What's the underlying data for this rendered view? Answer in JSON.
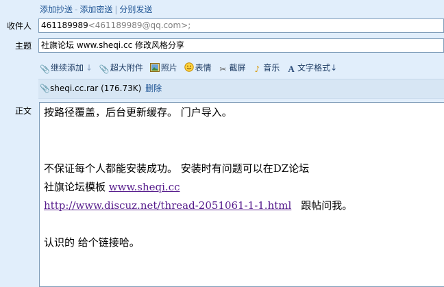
{
  "top_links": {
    "add_cc": "添加抄送",
    "sep1": "-",
    "add_bcc": "添加密送",
    "sep2": "|",
    "send_separately": "分别发送"
  },
  "recipients": {
    "label": "收件人",
    "name": "461189989",
    "email": "<461189989@qq.com>;"
  },
  "subject": {
    "label": "主题",
    "value": "社旗论坛 www.sheqi.cc 修改风格分享"
  },
  "toolbar": {
    "continue_add": "继续添加",
    "large_attachment": "超大附件",
    "photo": "照片",
    "emoticon": "表情",
    "screenshot": "截屏",
    "music": "音乐",
    "text_format": "文字格式"
  },
  "attachment": {
    "filename": "sheqi.cc.rar",
    "size": "(176.73K)",
    "delete": "删除"
  },
  "body": {
    "label": "正文",
    "line1": "按路径覆盖，后台更新缓存。   门户导入。",
    "line2": "不保证每个人都能安装成功。  安装时有问题可以在DZ论坛",
    "line3_text": "社旗论坛模板 ",
    "line3_link": "www.sheqi.cc",
    "line4_link": "http://www.discuz.net/thread-2051061-1-1.html",
    "line4_text": "跟帖问我。",
    "line5": "认识的   给个链接哈。"
  }
}
